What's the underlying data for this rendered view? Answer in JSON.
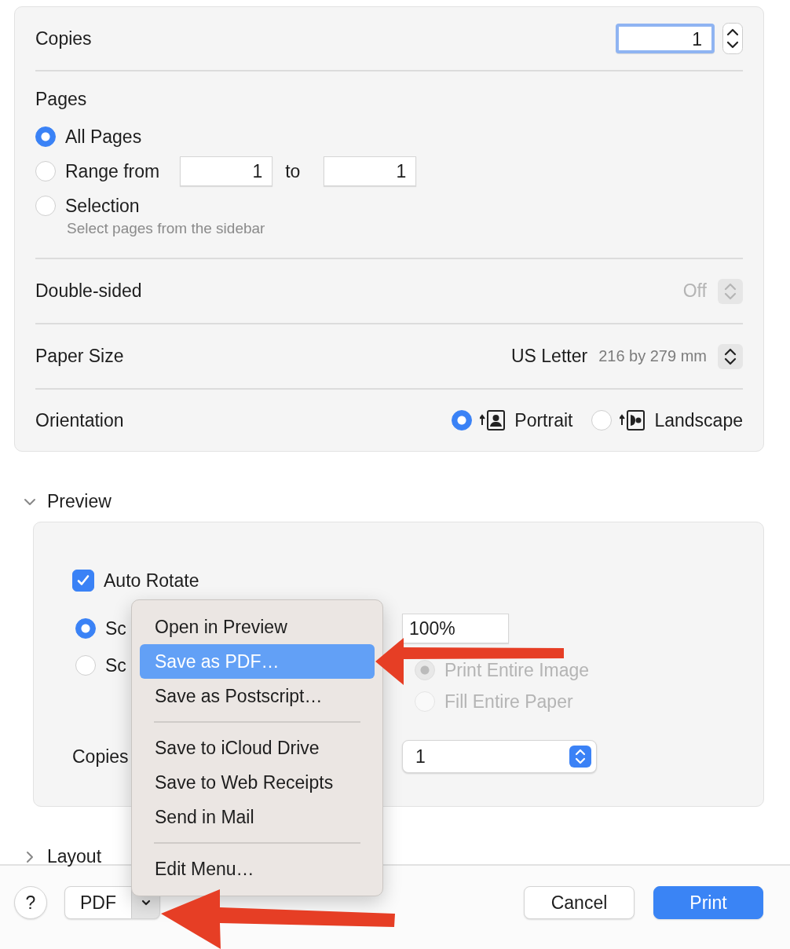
{
  "copies": {
    "label": "Copies",
    "value": "1",
    "focused": true
  },
  "pages": {
    "title": "Pages",
    "options": [
      {
        "label": "All Pages",
        "selected": true
      },
      {
        "label": "Range from",
        "selected": false,
        "from": "1",
        "to_label": "to",
        "to": "1"
      },
      {
        "label": "Selection",
        "selected": false,
        "hint": "Select pages from the sidebar"
      }
    ]
  },
  "double_sided": {
    "label": "Double-sided",
    "value": "Off",
    "disabled": true
  },
  "paper_size": {
    "label": "Paper Size",
    "value": "US Letter",
    "detail": "216 by 279 mm"
  },
  "orientation": {
    "label": "Orientation",
    "options": [
      {
        "label": "Portrait",
        "selected": true
      },
      {
        "label": "Landscape",
        "selected": false
      }
    ]
  },
  "preview": {
    "title": "Preview",
    "expanded": true,
    "auto_rotate": {
      "label": "Auto Rotate",
      "checked": true
    },
    "scale_options": [
      {
        "label": "Sc",
        "selected": true
      },
      {
        "label": "Sc",
        "selected": false
      }
    ],
    "scale_value": "100%",
    "fit_options": [
      {
        "label": "Print Entire Image",
        "selected": true,
        "disabled": true
      },
      {
        "label": "Fill Entire Paper",
        "selected": false,
        "disabled": true
      }
    ],
    "copies_per_page": {
      "label": "Copies",
      "value": "1"
    }
  },
  "layout_section": {
    "title": "Layout",
    "expanded": false
  },
  "pdf_menu": {
    "items": [
      {
        "kind": "item",
        "label": "Open in Preview",
        "selected": false
      },
      {
        "kind": "item",
        "label": "Save as PDF…",
        "selected": true
      },
      {
        "kind": "item",
        "label": "Save as Postscript…",
        "selected": false
      },
      {
        "kind": "separator"
      },
      {
        "kind": "item",
        "label": "Save to iCloud Drive",
        "selected": false
      },
      {
        "kind": "item",
        "label": "Save to Web Receipts",
        "selected": false
      },
      {
        "kind": "item",
        "label": "Send in Mail",
        "selected": false
      },
      {
        "kind": "separator"
      },
      {
        "kind": "item",
        "label": "Edit Menu…",
        "selected": false
      }
    ]
  },
  "footer": {
    "help": "?",
    "pdf": "PDF",
    "cancel": "Cancel",
    "print": "Print"
  }
}
